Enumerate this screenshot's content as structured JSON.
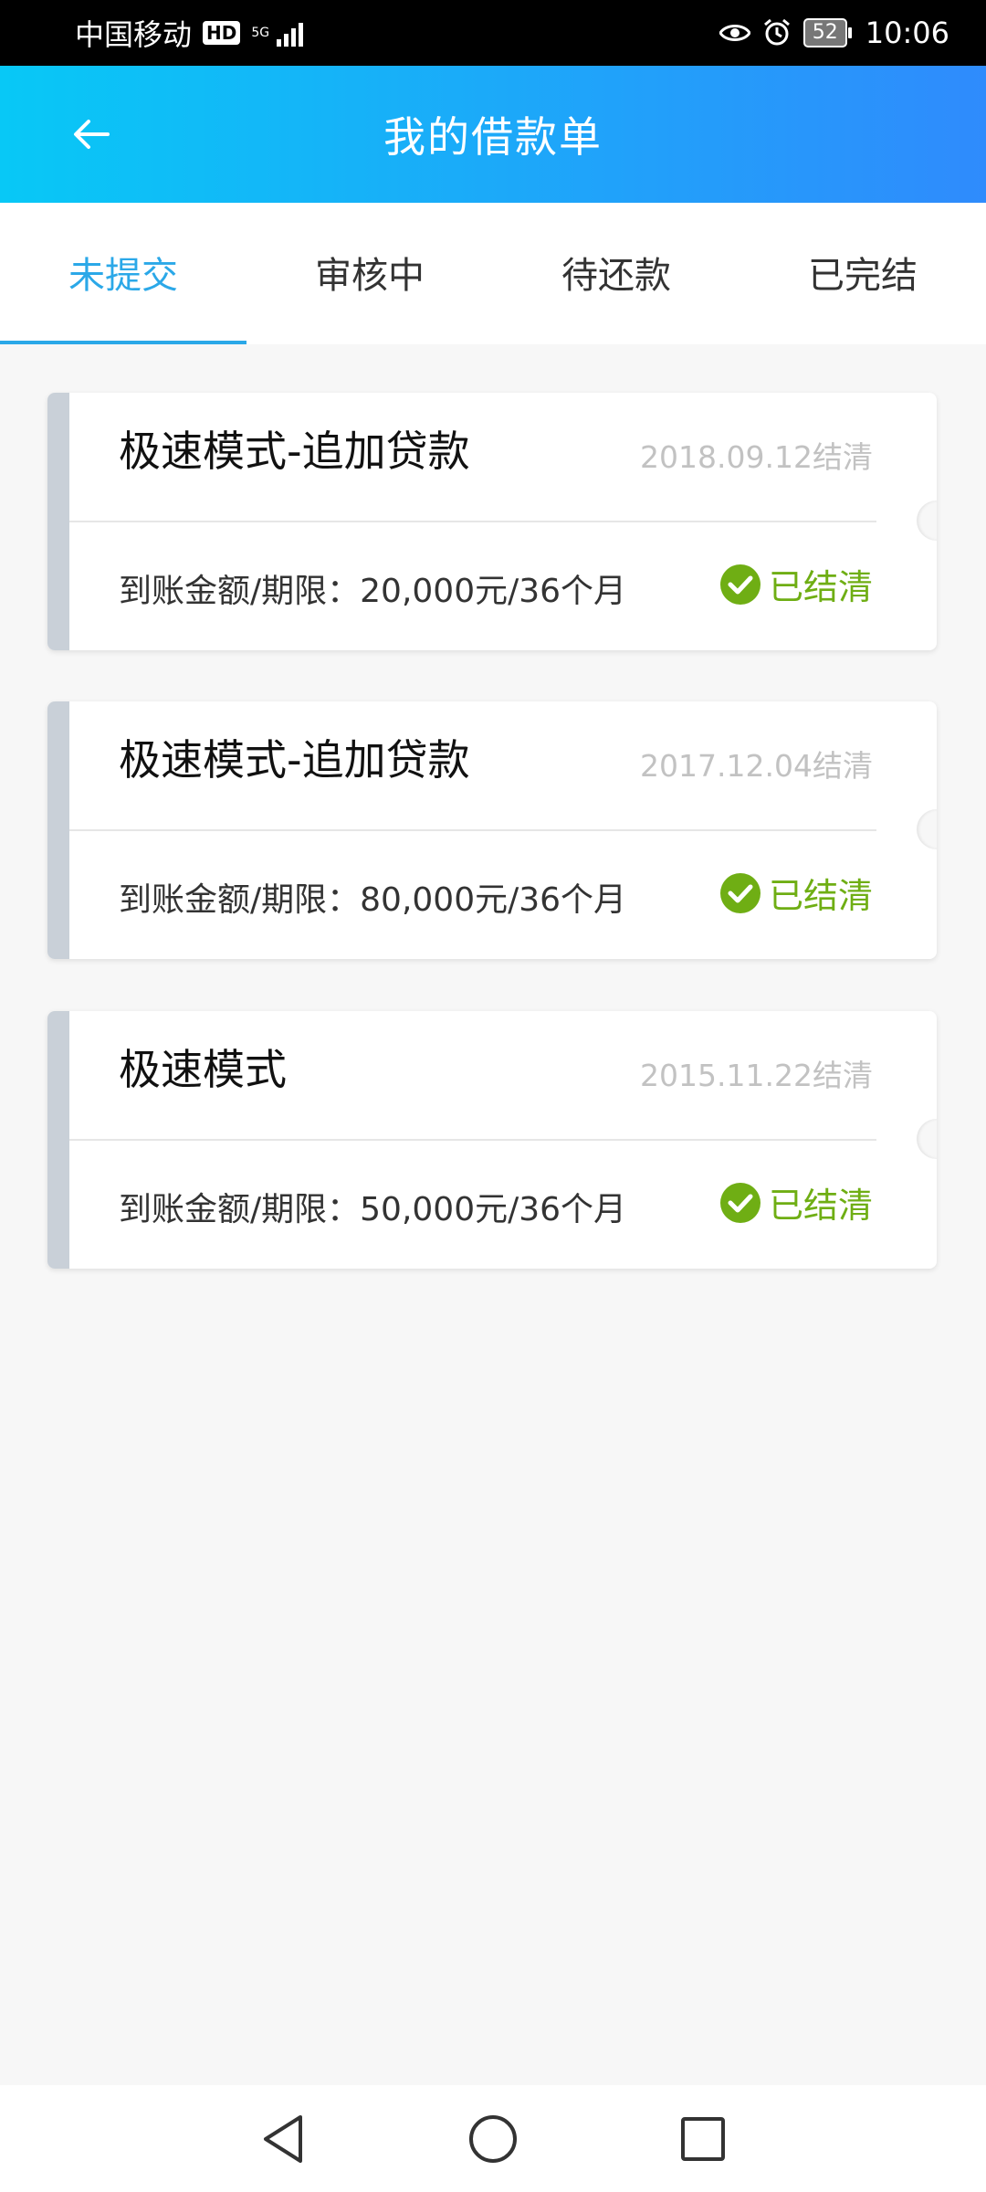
{
  "status_bar": {
    "carrier": "中国移动",
    "hd": "HD",
    "network": "5G",
    "battery": "52",
    "time": "10:06"
  },
  "header": {
    "title": "我的借款单",
    "back_icon": "arrow-left-icon"
  },
  "tabs": [
    {
      "label": "未提交",
      "active": true
    },
    {
      "label": "审核中",
      "active": false
    },
    {
      "label": "待还款",
      "active": false
    },
    {
      "label": "已完结",
      "active": false
    }
  ],
  "loans": [
    {
      "title": "极速模式-追加贷款",
      "date": "2018.09.12结清",
      "detail": "到账金额/期限：20,000元/36个月",
      "status": "已结清"
    },
    {
      "title": "极速模式-追加贷款",
      "date": "2017.12.04结清",
      "detail": "到账金额/期限：80,000元/36个月",
      "status": "已结清"
    },
    {
      "title": "极速模式",
      "date": "2015.11.22结清",
      "detail": "到账金额/期限：50,000元/36个月",
      "status": "已结清"
    }
  ],
  "colors": {
    "accent": "#2ba8e8",
    "header_start": "#08c8f6",
    "header_end": "#2f8bfc",
    "status_green": "#6fae14"
  }
}
